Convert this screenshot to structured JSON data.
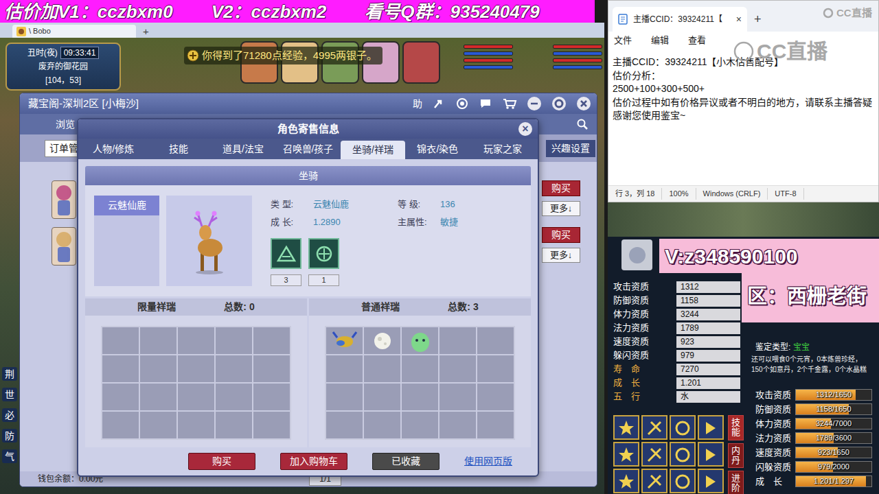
{
  "banner": {
    "segments": [
      "估价加V1：cczbxm0",
      "V2：cczbxm2",
      "看号Q群：935240479"
    ]
  },
  "browser": {
    "tab_title": "\\ Bobo",
    "new_tab": "+"
  },
  "game": {
    "period": "丑时(夜)",
    "clock": "09:33:41",
    "location": "废弃的御花园",
    "coords": "[104，53]",
    "message": "你得到了71280点经验，4995两银子。",
    "side_labels": [
      "荆",
      "世",
      "必",
      "防",
      "气"
    ]
  },
  "market": {
    "title": "藏宝阁-深圳2区 [小梅沙]",
    "help": "助",
    "nav": "浏览",
    "orders": "订单管",
    "interest": "兴趣设置",
    "listings": [
      {
        "buy": "购买",
        "more": "更多↓"
      },
      {
        "buy": "购买",
        "more": "更多↓"
      }
    ],
    "wallet": "钱包余额：0.00元",
    "page": "1/1"
  },
  "dialog": {
    "title": "角色寄售信息",
    "close": "×",
    "tabs": [
      {
        "label": "人物/修炼",
        "selected": false
      },
      {
        "label": "技能",
        "selected": false
      },
      {
        "label": "道具/法宝",
        "selected": false
      },
      {
        "label": "召唤兽/孩子",
        "selected": false
      },
      {
        "label": "坐骑/祥瑞",
        "selected": true
      },
      {
        "label": "锦衣/染色",
        "selected": false
      },
      {
        "label": "玩家之家",
        "selected": false
      }
    ],
    "section": "坐骑",
    "mounts": [
      {
        "name": "云魅仙鹿",
        "selected": true
      }
    ],
    "fields": [
      {
        "label": "类 型:",
        "value": "云魅仙鹿"
      },
      {
        "label": "等 级:",
        "value": "136"
      },
      {
        "label": "成 长:",
        "value": "1.2890"
      },
      {
        "label": "主属性:",
        "value": "敏捷"
      }
    ],
    "skills": [
      {
        "count": "3"
      },
      {
        "count": "1"
      }
    ],
    "limited": {
      "title": "限量祥瑞",
      "total_label": "总数:",
      "total": "0",
      "items": []
    },
    "normal": {
      "title": "普通祥瑞",
      "total_label": "总数:",
      "total": "3",
      "items": [
        {
          "kind": "beetle"
        },
        {
          "kind": "moon"
        },
        {
          "kind": "blob"
        }
      ]
    },
    "buttons": [
      {
        "label": "购买",
        "kind": "primary"
      },
      {
        "label": "加入购物车",
        "kind": "primary"
      },
      {
        "label": "已收藏",
        "kind": "muted"
      }
    ],
    "web_link": "使用网页版"
  },
  "notepad": {
    "tab": "主播CCID：39324211【",
    "tab_close": "×",
    "new_tab": "+",
    "menu": [
      "文件",
      "编辑",
      "查看"
    ],
    "lines": [
      "主播CCID：39324211【小木估售配号】",
      "估价分析：",
      "2500+100+300+500+",
      "估价过程中如有价格异议或者不明白的地方，请联系主播答疑",
      "感谢您使用鉴宝~"
    ],
    "status": [
      "行 3，列 18",
      "100%",
      "Windows (CRLF)",
      "UTF-8"
    ]
  },
  "watermarks": [
    "CC直播",
    "CC直播"
  ],
  "pet": {
    "contact": "V:z348590100",
    "zone": "区：西栅老街",
    "stats": [
      {
        "label": "攻击资质",
        "value": "1312",
        "color": "#ffffff"
      },
      {
        "label": "防御资质",
        "value": "1158",
        "color": "#ffffff"
      },
      {
        "label": "体力资质",
        "value": "3244",
        "color": "#ffffff"
      },
      {
        "label": "法力资质",
        "value": "1789",
        "color": "#ffffff"
      },
      {
        "label": "速度资质",
        "value": "923",
        "color": "#ffffff"
      },
      {
        "label": "躲闪资质",
        "value": "979",
        "color": "#ffffff"
      },
      {
        "label": "寿　命",
        "value": "7270",
        "color": "#f0b040"
      },
      {
        "label": "成　长",
        "value": "1.201",
        "color": "#f0b040"
      },
      {
        "label": "五　行",
        "value": "水",
        "color": "#f0b040"
      }
    ],
    "appraisal_label": "鉴定类型:",
    "appraisal": "宝宝",
    "feed_notes": [
      "还可以喂食0个元宵，0本炼兽珍经，",
      "150个如意丹，2个千金露，0个水晶糕"
    ],
    "bars": [
      {
        "label": "攻击资质",
        "reading": "1312/1650",
        "level": 0.795
      },
      {
        "label": "防御资质",
        "reading": "1158/1650",
        "level": 0.702
      },
      {
        "label": "体力资质",
        "reading": "3244/7000",
        "level": 0.463
      },
      {
        "label": "法力资质",
        "reading": "1789/3600",
        "level": 0.497
      },
      {
        "label": "速度资质",
        "reading": "923/1650",
        "level": 0.559
      },
      {
        "label": "闪躲资质",
        "reading": "979/2000",
        "level": 0.49
      },
      {
        "label": "成　长",
        "reading": "1.201/1.297",
        "level": 0.926
      }
    ],
    "tabs": [
      {
        "label": "技能",
        "selected": true
      },
      {
        "label": "内丹",
        "selected": false
      },
      {
        "label": "进阶",
        "selected": false
      }
    ]
  }
}
